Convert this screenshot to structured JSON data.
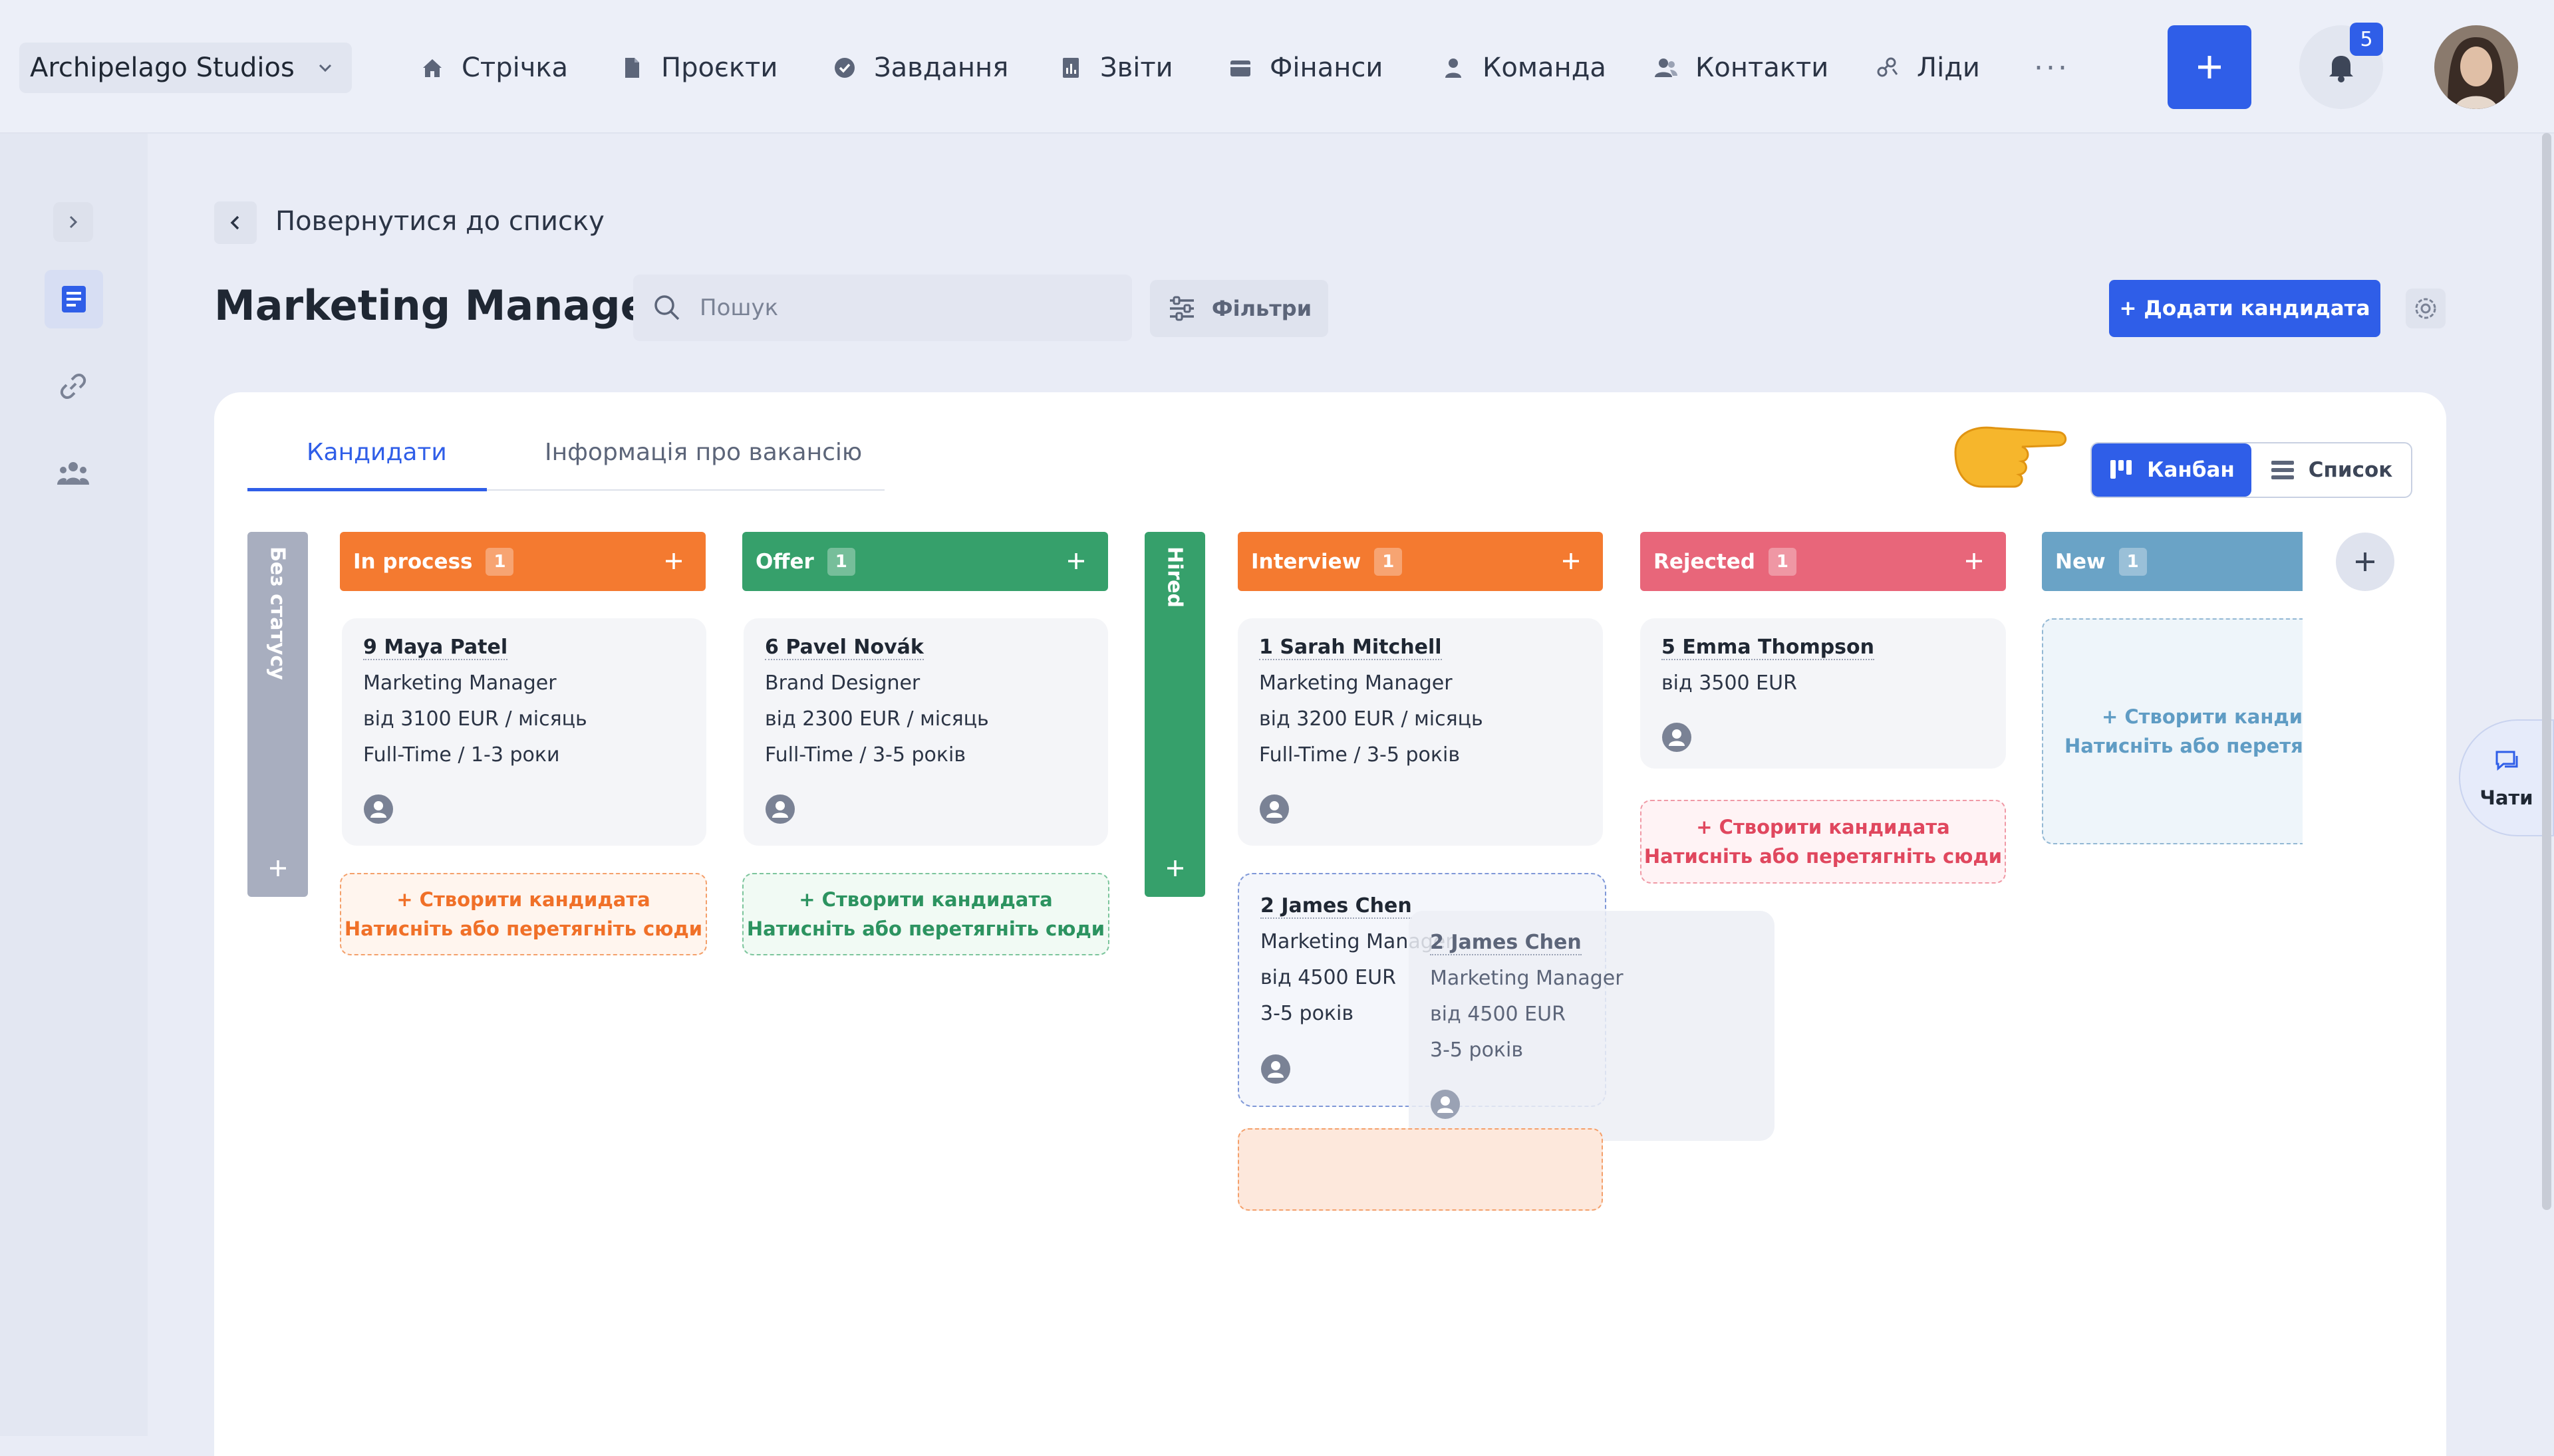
{
  "company": "Archipelago Studios",
  "nav": [
    {
      "label": "Стрічка",
      "icon": "home-icon"
    },
    {
      "label": "Проєкти",
      "icon": "document-icon"
    },
    {
      "label": "Завдання",
      "icon": "check-circle-icon"
    },
    {
      "label": "Звіти",
      "icon": "report-icon"
    },
    {
      "label": "Фінанси",
      "icon": "wallet-icon"
    },
    {
      "label": "Команда",
      "icon": "person-icon"
    },
    {
      "label": "Контакти",
      "icon": "contacts-icon"
    },
    {
      "label": "Ліди",
      "icon": "leads-icon"
    }
  ],
  "nav_more": "···",
  "notifications_count": "5",
  "back_label": "Повернутися до списку",
  "page_title": "Marketing Manager",
  "search": {
    "placeholder": "Пошук"
  },
  "filters_label": "Фільтри",
  "add_candidate_label": "+ Додати кандидата",
  "tabs": [
    {
      "label": "Кандидати",
      "active": true
    },
    {
      "label": "Інформація про вакансію",
      "active": false
    }
  ],
  "view_toggle": {
    "kanban": "Канбан",
    "list": "Список",
    "selected": "kanban"
  },
  "columns": {
    "no_status": {
      "label": "Без статусу",
      "color": "#a8aebf"
    },
    "in_process": {
      "label": "In process",
      "count": "1",
      "color": "#f47a30",
      "card": {
        "name": "9 Maya Patel",
        "role": "Marketing Manager",
        "salary": "від 3100 EUR / місяць",
        "type": "Full-Time / 1-3 роки"
      }
    },
    "offer": {
      "label": "Offer",
      "count": "1",
      "color": "#36a06b",
      "card": {
        "name": "6 Pavel Novák",
        "role": "Brand Designer",
        "salary": "від 2300 EUR / місяць",
        "type": "Full-Time / 3-5 років"
      }
    },
    "hired": {
      "label": "Hired",
      "color": "#36a06b"
    },
    "interview": {
      "label": "Interview",
      "count": "1",
      "color": "#f47a30",
      "card": {
        "name": "1 Sarah Mitchell",
        "role": "Marketing Manager",
        "salary": "від 3200 EUR / місяць",
        "type": "Full-Time / 3-5 років"
      },
      "card2": {
        "name": "2 James Chen",
        "role": "Marketing Manager",
        "salary": "від 4500 EUR",
        "type": "3-5 років"
      },
      "ghost": {
        "name": "2 James Chen",
        "role": "Marketing Manager",
        "salary": "від 4500 EUR",
        "type": "3-5 років"
      }
    },
    "rejected": {
      "label": "Rejected",
      "count": "1",
      "color": "#e8667a",
      "card": {
        "name": "5 Emma Thompson",
        "salary": "від 3500 EUR"
      }
    },
    "new": {
      "label": "New",
      "count": "1",
      "color": "#6aa3c6"
    }
  },
  "drop_zone": {
    "create": "+ Створити кандидата",
    "hint": "Натисніть або перетягніть сюди"
  },
  "new_col_drop": {
    "create": "+ Створити кандид",
    "hint": "Натисніть або перетягні"
  },
  "chats_label": "Чати"
}
